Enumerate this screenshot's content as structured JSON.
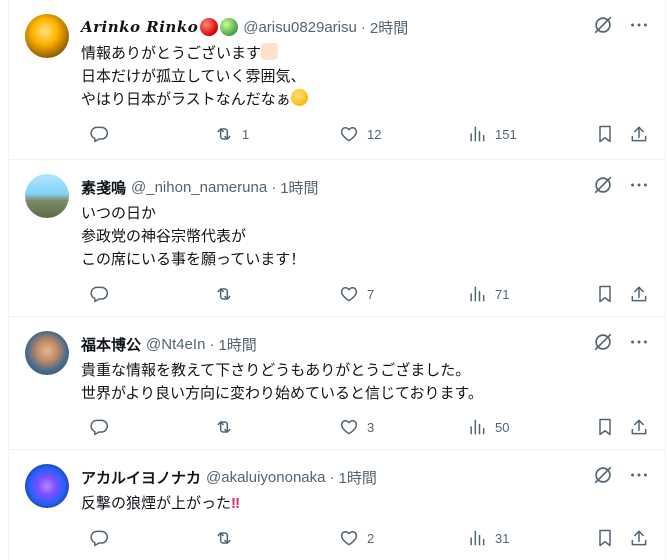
{
  "tweets": [
    {
      "name": "Arinko Rinko",
      "name_emojis": [
        "red-apple",
        "green-apple"
      ],
      "handle": "@arisu0829arisu",
      "dot": "·",
      "time": "2時間",
      "lines": [
        "情報ありがとうございます",
        "日本だけが孤立していく雰囲気、",
        "やはり日本がラストなんだなぁ"
      ],
      "line_emojis": [
        "folded-hands",
        "",
        "relieved-face"
      ],
      "reply_count": "",
      "retweet_count": "1",
      "like_count": "12",
      "view_count": "151"
    },
    {
      "name": "素戔嗚",
      "handle": "@_nihon_nameruna",
      "dot": "·",
      "time": "1時間",
      "lines": [
        "いつの日か",
        "参政党の神谷宗幣代表が",
        "この席にいる事を願っています！"
      ],
      "reply_count": "",
      "retweet_count": "",
      "like_count": "7",
      "view_count": "71"
    },
    {
      "name": "福本博公",
      "handle": "@Nt4eIn",
      "dot": "·",
      "time": "1時間",
      "lines": [
        "貴重な情報を教えて下さりどうもありがとうござました。",
        "世界がより良い方向に変わり始めていると信じております。"
      ],
      "reply_count": "",
      "retweet_count": "",
      "like_count": "3",
      "view_count": "50"
    },
    {
      "name": "アカルイヨノナカ",
      "handle": "@akaluiyononaka",
      "dot": "·",
      "time": "1時間",
      "lines": [
        "反撃の狼煙が上がった"
      ],
      "line_emojis": [
        "double-exclamation"
      ],
      "bang": "‼",
      "reply_count": "",
      "retweet_count": "",
      "like_count": "2",
      "view_count": "31"
    }
  ],
  "icons": {
    "grok": "grok-icon",
    "more": "more-icon",
    "reply": "reply-icon",
    "retweet": "retweet-icon",
    "like": "like-icon",
    "views": "views-icon",
    "bookmark": "bookmark-icon",
    "share": "share-icon"
  },
  "colors": {
    "text": "#0f1419",
    "secondary": "#536471",
    "border": "#eff3f4"
  }
}
